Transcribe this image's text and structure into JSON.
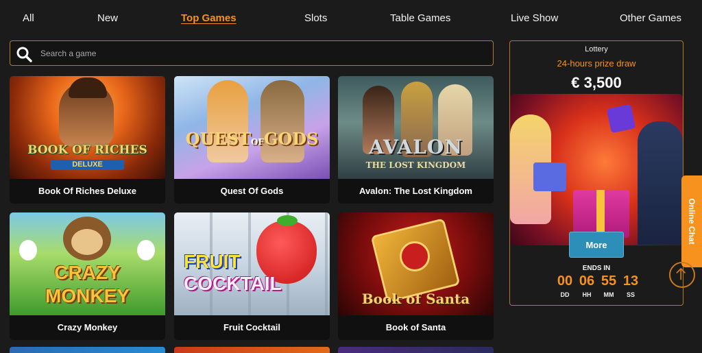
{
  "nav": {
    "items": [
      {
        "label": "All"
      },
      {
        "label": "New"
      },
      {
        "label": "Top Games"
      },
      {
        "label": "Slots"
      },
      {
        "label": "Table Games"
      },
      {
        "label": "Live Show"
      },
      {
        "label": "Other Games"
      }
    ],
    "active": "Top Games"
  },
  "search": {
    "placeholder": "Search a game",
    "icon": "search-icon"
  },
  "games": [
    {
      "title": "Book Of Riches Deluxe",
      "logo_lines": [
        "BOOK OF RICHES",
        "DELUXE"
      ]
    },
    {
      "title": "Quest Of Gods",
      "logo_lines": [
        "QUEST",
        "OF",
        "GODS"
      ]
    },
    {
      "title": "Avalon: The Lost Kingdom",
      "logo_lines": [
        "AVALON",
        "THE LOST KINGDOM"
      ]
    },
    {
      "title": "Crazy Monkey",
      "logo_lines": [
        "CRAZY",
        "MONKEY"
      ]
    },
    {
      "title": "Fruit Cocktail",
      "logo_lines": [
        "FRUIT",
        "COCKTAIL"
      ]
    },
    {
      "title": "Book of Santa",
      "logo_lines": [
        "Book of Santa"
      ]
    }
  ],
  "lottery": {
    "title": "Lottery",
    "subtitle": "24-hours prize draw",
    "prize": "€ 3,500",
    "more_label": "More",
    "ends_label": "ENDS IN",
    "timer": [
      {
        "value": "00",
        "unit": "DD"
      },
      {
        "value": "06",
        "unit": "HH"
      },
      {
        "value": "55",
        "unit": "MM"
      },
      {
        "value": "13",
        "unit": "SS"
      }
    ]
  },
  "chat": {
    "label": "Online Chat"
  },
  "colors": {
    "accent": "#f7921e",
    "border": "#b47a1c",
    "button": "#2d8fb8",
    "background": "#1b1b1c"
  }
}
